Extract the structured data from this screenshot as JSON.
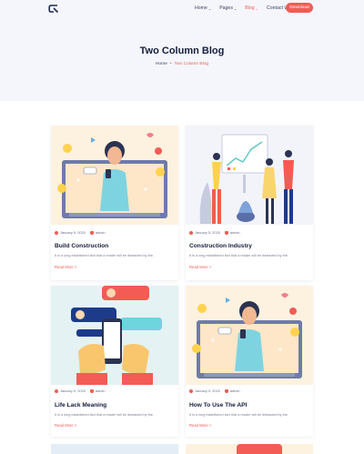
{
  "nav": {
    "items": [
      {
        "label": "Home",
        "caret": "⌄"
      },
      {
        "label": "Pages",
        "caret": "⌄"
      },
      {
        "label": "Blog",
        "caret": "⌄"
      },
      {
        "label": "Contact Us",
        "caret": "⌄"
      }
    ],
    "download_label": "Download",
    "accent_color": "#f25c54"
  },
  "header": {
    "title": "Two Column Blog",
    "breadcrumb": {
      "home": "Home",
      "separator": "•",
      "current": "Two Column Blog"
    }
  },
  "posts": [
    {
      "date": "January 9, 2020",
      "author": "admin",
      "title": "Build Construction",
      "excerpt": "It is a long established fact that a reader will be distracted by the.",
      "link": "Read More >",
      "illustration": "man-on-phone-with-emojis"
    },
    {
      "date": "January 5, 2020",
      "author": "admin",
      "title": "Construction Industry",
      "excerpt": "It is a long established fact that a reader will be distracted by the.",
      "link": "Read More >",
      "illustration": "team-presenting-chart"
    },
    {
      "date": "January 9, 2020",
      "author": "admin",
      "title": "Life Lack Meaning",
      "excerpt": "It is a long established fact that a reader will be distracted by the.",
      "link": "Read More >",
      "illustration": "hands-holding-phone-chat"
    },
    {
      "date": "January 9, 2020",
      "author": "admin",
      "title": "How To Use The API",
      "excerpt": "It is a long established fact that a reader will be distracted by the.",
      "link": "Read More >",
      "illustration": "man-on-phone-with-emojis"
    }
  ]
}
